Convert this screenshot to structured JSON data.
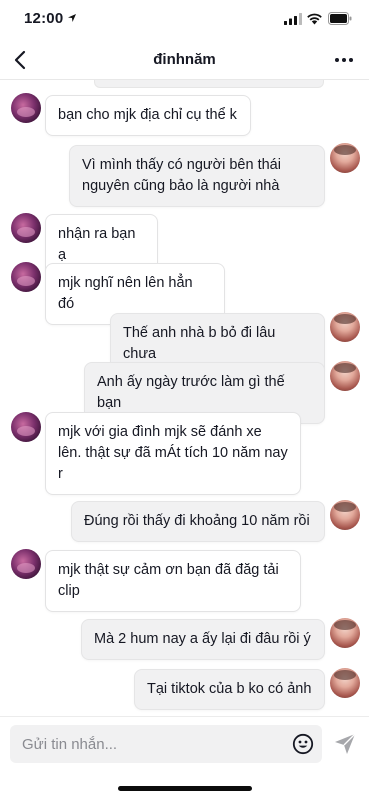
{
  "status_bar": {
    "time": "12:00"
  },
  "header": {
    "title": "đinhnăm"
  },
  "messages": [
    {
      "sender": "them",
      "text": "bạn cho mjk địa chỉ cụ thể k"
    },
    {
      "sender": "me",
      "text": "Vì mình thấy có người bên thái nguyên cũng bảo là người nhà"
    },
    {
      "sender": "them",
      "text": "nhận ra bạn ạ"
    },
    {
      "sender": "them",
      "text": "mjk nghĩ nên lên hẳn đó"
    },
    {
      "sender": "me",
      "text": "Thế anh nhà b bỏ đi lâu chưa"
    },
    {
      "sender": "me",
      "text": "Anh ấy ngày trước làm gì thế bạn"
    },
    {
      "sender": "them",
      "text": "mjk với gia đình mjk sẽ đánh xe lên. thật sự đã mÁt tích 10 năm nay r"
    },
    {
      "sender": "me",
      "text": "Đúng rồi thấy đi khoảng 10 năm rồi"
    },
    {
      "sender": "them",
      "text": "mjk thật sự cảm ơn bạn đã đăg tải clip"
    },
    {
      "sender": "me",
      "text": "Mà 2 hum nay a ấy lại đi đâu rồi ý"
    },
    {
      "sender": "me",
      "text": "Tại tiktok của b ko có ảnh"
    }
  ],
  "input": {
    "placeholder": "Gửi tin nhắn..."
  },
  "icons": {
    "back": "chevron-left-icon",
    "more": "more-horizontal-icon",
    "emoji": "emoji-icon",
    "send": "send-icon"
  }
}
